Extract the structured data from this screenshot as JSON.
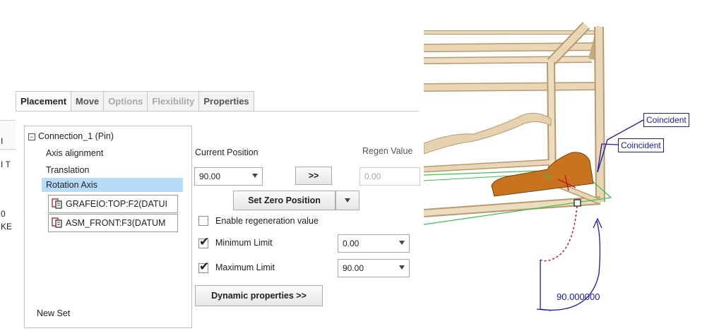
{
  "left_fragments": [
    "I",
    "I T",
    "0",
    "KE"
  ],
  "tabs": [
    {
      "label": "Placement",
      "state": "active"
    },
    {
      "label": "Move",
      "state": "normal"
    },
    {
      "label": "Options",
      "state": "disabled"
    },
    {
      "label": "Flexibility",
      "state": "disabled"
    },
    {
      "label": "Properties",
      "state": "normal"
    }
  ],
  "tree": {
    "root": "Connection_1 (Pin)",
    "items": [
      "Axis alignment",
      "Translation",
      "Rotation Axis"
    ],
    "selected": "Rotation Axis",
    "references": [
      "GRAFEIO:TOP:F2(DATUI",
      "ASM_FRONT:F3(DATUM"
    ],
    "new_set": "New Set"
  },
  "position": {
    "current_label": "Current Position",
    "current_value": "90.00",
    "copy_button": ">>",
    "regen_label": "Regen Value",
    "regen_value": "0.00",
    "set_zero_button": "Set Zero Position"
  },
  "options": {
    "enable_regen_label": "Enable regeneration value",
    "enable_regen_checked": false,
    "min_label": "Minimum Limit",
    "min_checked": true,
    "min_value": "0.00",
    "max_label": "Maximum Limit",
    "max_checked": true,
    "max_value": "90.00",
    "dynamic_button": "Dynamic properties >>"
  },
  "view3d": {
    "callouts": [
      "Coincident",
      "Coincident"
    ],
    "angle": "90.000000",
    "colors": {
      "frame": "#e6d3b2",
      "part": "#c8741e",
      "datum": "#36c24a",
      "annotation": "#1a1aa8",
      "dash": "#c0141e"
    }
  }
}
